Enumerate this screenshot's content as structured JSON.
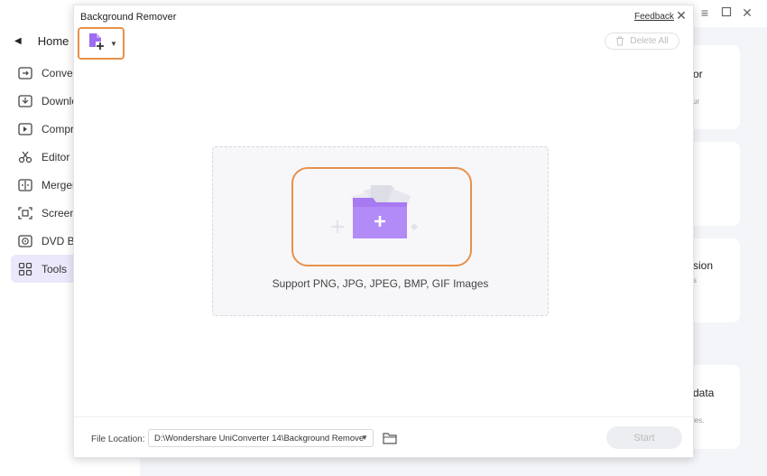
{
  "app": {
    "window_controls": [
      "minimize",
      "maximize",
      "close"
    ],
    "nav": {
      "home_label": "Home",
      "items": [
        {
          "label": "Conver",
          "icon": "converter-icon"
        },
        {
          "label": "Downlo",
          "icon": "download-icon"
        },
        {
          "label": "Compre",
          "icon": "compress-icon"
        },
        {
          "label": "Editor",
          "icon": "scissors-icon"
        },
        {
          "label": "Merger",
          "icon": "merger-icon"
        },
        {
          "label": "Screen",
          "icon": "screen-recorder-icon"
        },
        {
          "label": "DVD Bu",
          "icon": "dvd-icon"
        },
        {
          "label": "Tools",
          "icon": "tools-grid-icon",
          "active": true
        }
      ]
    },
    "cards": [
      {
        "title": "or",
        "sub": "ur"
      },
      {
        "title": "",
        "sub": ""
      },
      {
        "title": "sion",
        "sub": "s"
      },
      {
        "title": "data",
        "sub": "les."
      }
    ]
  },
  "dialog": {
    "title": "Background Remover",
    "feedback": "Feedback",
    "delete_all": "Delete All",
    "support_text": "Support PNG, JPG, JPEG, BMP, GIF Images",
    "file_location_label": "File Location:",
    "file_location_value": "D:\\Wondershare UniConverter 14\\Background Remove",
    "start": "Start"
  },
  "colors": {
    "accent_orange": "#e8914a",
    "purple": "#9d6cf0",
    "active_nav": "#ece8fb"
  }
}
